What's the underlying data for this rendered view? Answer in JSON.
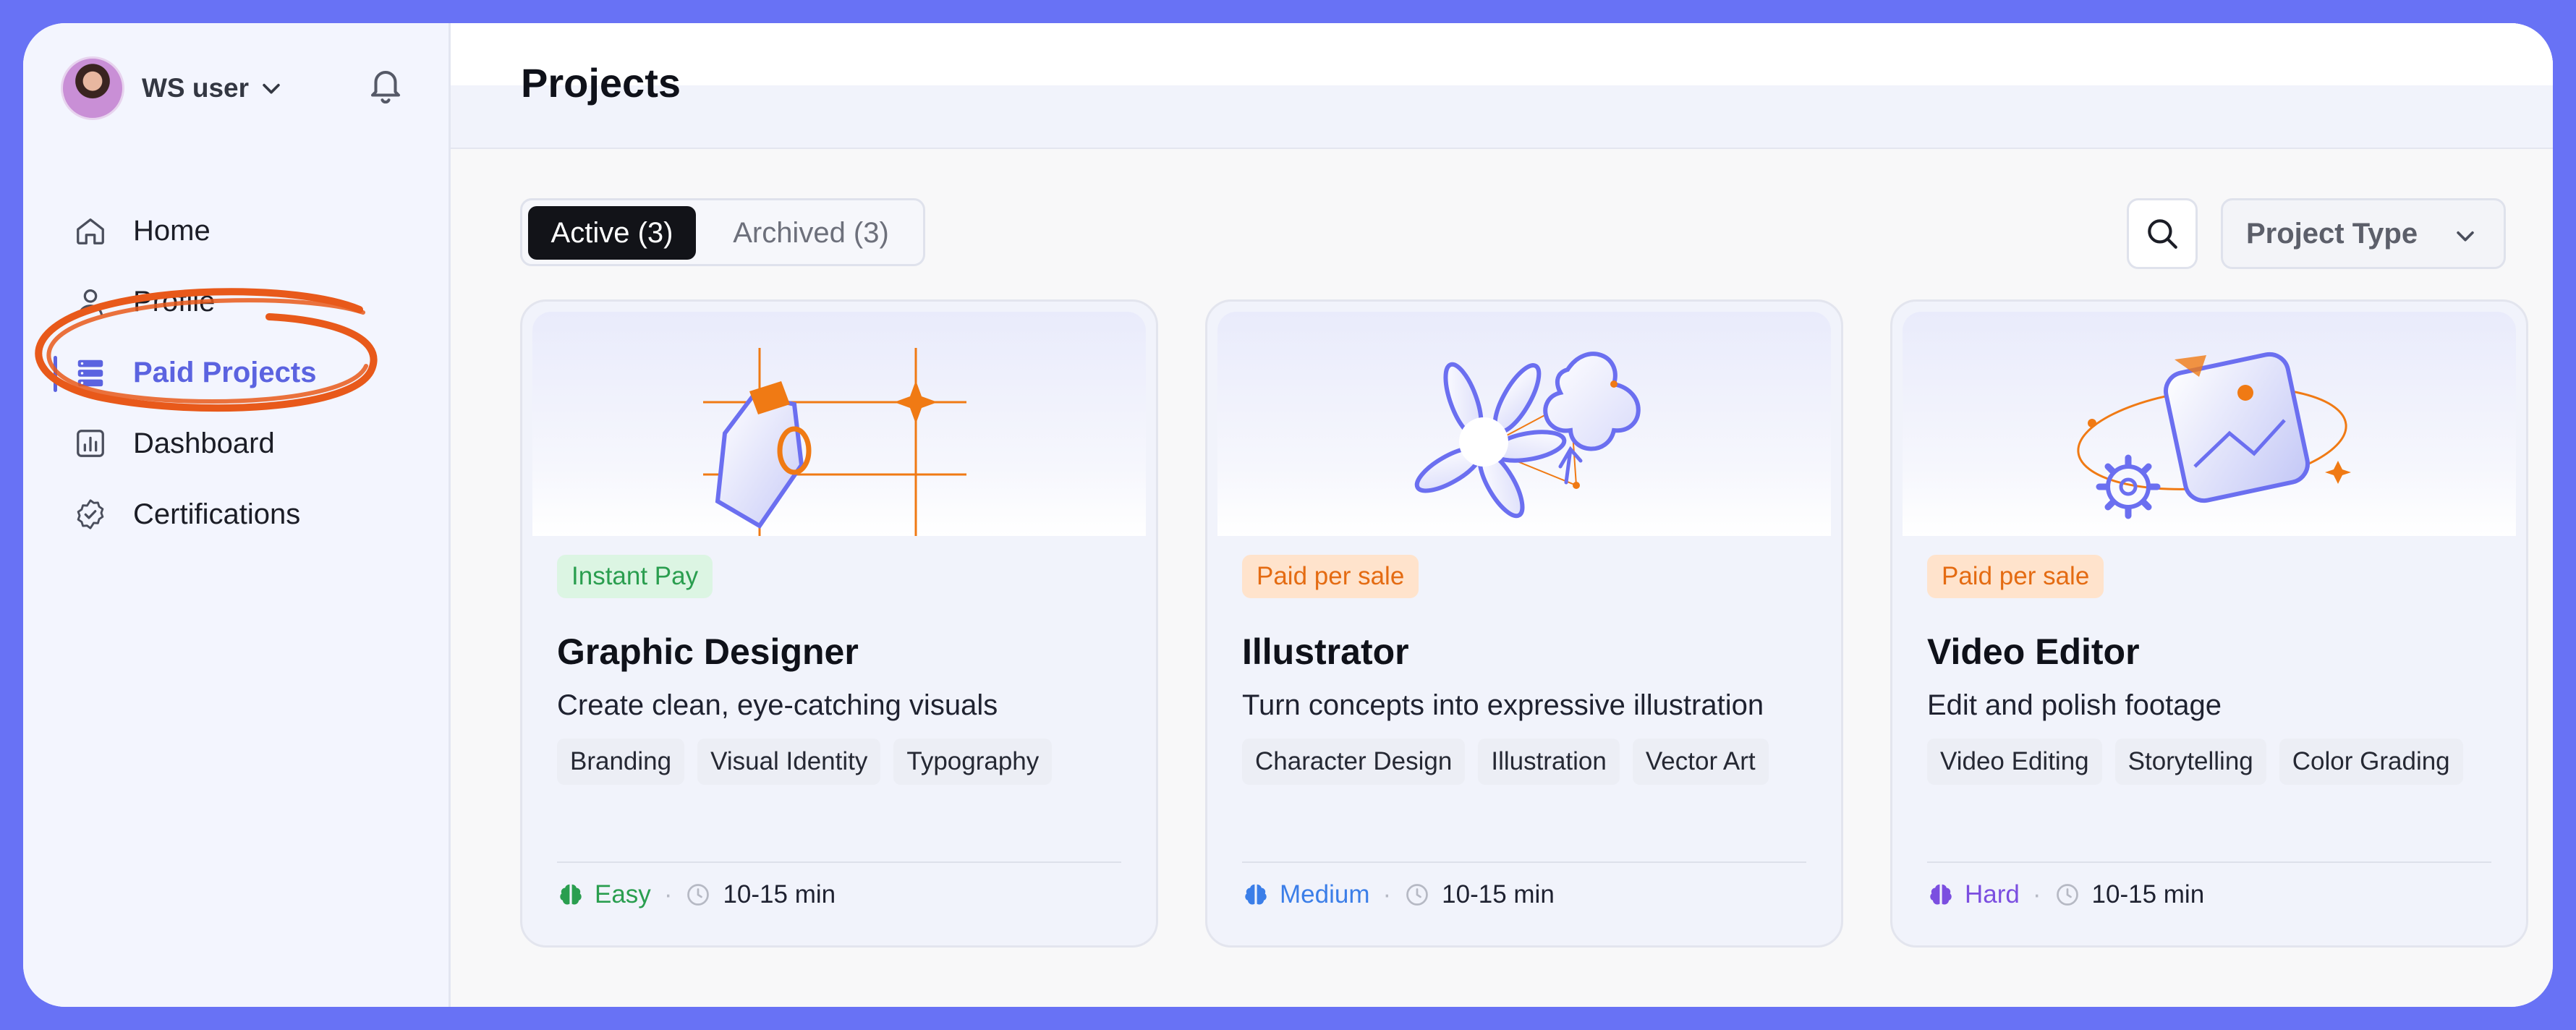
{
  "sidebar": {
    "user_name": "WS user",
    "nav": [
      {
        "label": "Home",
        "icon": "home-icon"
      },
      {
        "label": "Profile",
        "icon": "user-icon"
      },
      {
        "label": "Paid Projects",
        "icon": "stack-icon",
        "active": true
      },
      {
        "label": "Dashboard",
        "icon": "chart-icon"
      },
      {
        "label": "Certifications",
        "icon": "badge-check-icon"
      }
    ]
  },
  "header": {
    "title": "Projects"
  },
  "tabs": [
    {
      "label": "Active (3)",
      "active": true
    },
    {
      "label": "Archived (3)",
      "active": false
    }
  ],
  "filters": {
    "project_type": "Project Type"
  },
  "cards": [
    {
      "badge": "Instant Pay",
      "badge_color": "#2a9e4f",
      "title": "Graphic Designer",
      "desc": "Create clean, eye-catching visuals",
      "tags": [
        "Branding",
        "Visual Identity",
        "Typography"
      ],
      "level": "Easy",
      "level_color": "#2a9e4f",
      "time": "10-15 min"
    },
    {
      "badge": "Paid per sale",
      "badge_color": "#e46b12",
      "title": "Illustrator",
      "desc": "Turn concepts into expressive illustration",
      "tags": [
        "Character Design",
        "Illustration",
        "Vector Art"
      ],
      "level": "Medium",
      "level_color": "#3b7ee8",
      "time": "10-15 min"
    },
    {
      "badge": "Paid per sale",
      "badge_color": "#e46b12",
      "title": "Video Editor",
      "desc": "Edit and polish footage",
      "tags": [
        "Video Editing",
        "Storytelling",
        "Color Grading"
      ],
      "level": "Hard",
      "level_color": "#7b4ee0",
      "time": "10-15 min"
    }
  ],
  "colors": {
    "frame": "#6872f5",
    "accent": "#5b63e0",
    "annotation": "#e8591a"
  }
}
